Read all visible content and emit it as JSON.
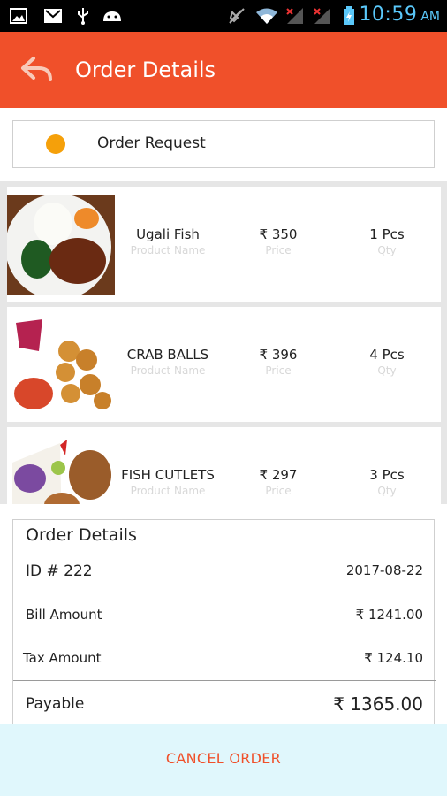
{
  "status_bar": {
    "time": "10:59",
    "ampm": "AM",
    "icons": [
      "image-icon",
      "gmail-icon",
      "usb-icon",
      "android-icon",
      "mute-icon",
      "wifi-icon",
      "signal-icon",
      "signal-icon",
      "battery-icon"
    ]
  },
  "app_bar": {
    "title": "Order Details",
    "back_icon": "back-arrow-icon"
  },
  "order_request": {
    "label": "Order Request",
    "status_color": "#f5a00a"
  },
  "products": [
    {
      "name": "Ugali Fish",
      "name_label": "Product Name",
      "price": "₹ 350",
      "price_label": "Price",
      "qty": "1 Pcs",
      "qty_label": "Qty"
    },
    {
      "name": "CRAB BALLS",
      "name_label": "Product Name",
      "price": "₹ 396",
      "price_label": "Price",
      "qty": "4 Pcs",
      "qty_label": "Qty"
    },
    {
      "name": "FISH CUTLETS",
      "name_label": "Product Name",
      "price": "₹ 297",
      "price_label": "Price",
      "qty": "3 Pcs",
      "qty_label": "Qty"
    }
  ],
  "order_details": {
    "heading": "Order Details",
    "id_label": "ID # 222",
    "date": "2017-08-22",
    "bill_label": "Bill Amount",
    "bill_value": "₹ 1241.00",
    "tax_label": "Tax Amount",
    "tax_value": "₹ 124.10",
    "payable_label": "Payable",
    "payable_value": "₹ 1365.00"
  },
  "actions": {
    "cancel_label": "CANCEL ORDER"
  },
  "colors": {
    "accent": "#f0502a",
    "status_dot": "#f5a00a",
    "footer_bg": "#e0f7fc"
  }
}
